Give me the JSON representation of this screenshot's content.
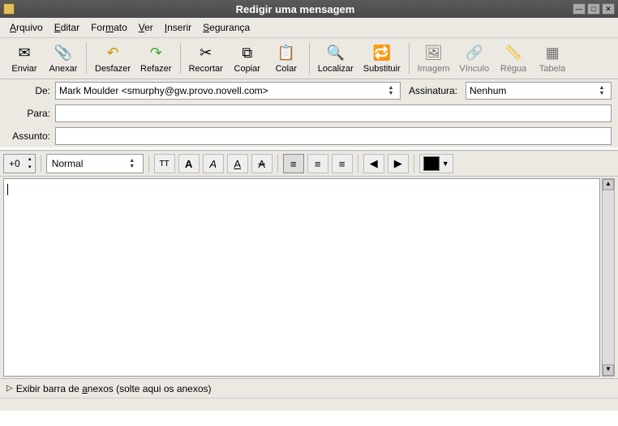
{
  "window": {
    "title": "Redigir uma mensagem"
  },
  "menu": {
    "arquivo": "Arquivo",
    "editar": "Editar",
    "formato": "Formato",
    "ver": "Ver",
    "inserir": "Inserir",
    "seguranca": "Segurança"
  },
  "toolbar": {
    "enviar": "Enviar",
    "anexar": "Anexar",
    "desfazer": "Desfazer",
    "refazer": "Refazer",
    "recortar": "Recortar",
    "copiar": "Copiar",
    "colar": "Colar",
    "localizar": "Localizar",
    "substituir": "Substituir",
    "imagem": "Imagem",
    "vinculo": "Vínculo",
    "regua": "Régua",
    "tabela": "Tabela"
  },
  "headers": {
    "de_label": "De:",
    "de_value": "Mark Moulder <smurphy@gw.provo.novell.com>",
    "para_label": "Para:",
    "para_value": "",
    "assunto_label": "Assunto:",
    "assunto_value": "",
    "assinatura_label": "Assinatura:",
    "assinatura_value": "Nenhum"
  },
  "format": {
    "size": "+0",
    "style": "Normal"
  },
  "attach": {
    "label": "Exibir barra de anexos (solte aqui os anexos)"
  },
  "attach_underline": "a"
}
